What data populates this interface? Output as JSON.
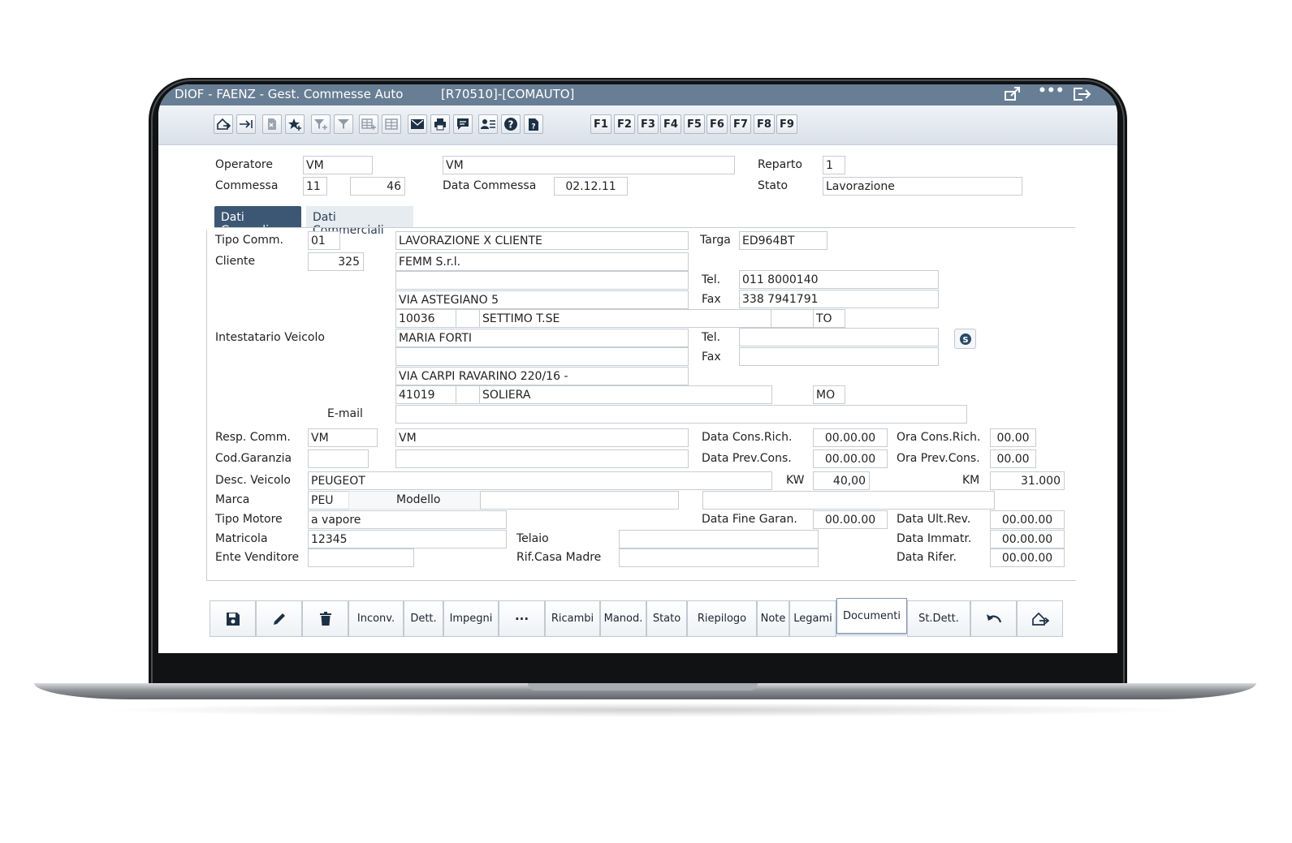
{
  "window": {
    "title": "DIOF  - FAENZ - Gest. Commesse Auto",
    "code": "[R70510]-[COMAUTO]"
  },
  "fkeys": [
    "F1",
    "F2",
    "F3",
    "F4",
    "F5",
    "F6",
    "F7",
    "F8",
    "F9"
  ],
  "header": {
    "operatore_label": "Operatore",
    "operatore_code": "VM",
    "operatore_name": "VM",
    "reparto_label": "Reparto",
    "reparto_value": "1",
    "commessa_label": "Commessa",
    "commessa_anno": "11",
    "commessa_num": "46",
    "data_commessa_label": "Data Commessa",
    "data_commessa_value": "02.12.11",
    "stato_label": "Stato",
    "stato_value": "Lavorazione"
  },
  "tabs": [
    "Dati Generali",
    "Dati Commerciali"
  ],
  "generali": {
    "tipo_comm_label": "Tipo Comm.",
    "tipo_comm_code": "01",
    "tipo_comm_desc": "LAVORAZIONE X CLIENTE",
    "targa_label": "Targa",
    "targa_value": "ED964BT",
    "cliente_label": "Cliente",
    "cliente_code": "325",
    "cliente_name": "FEMM S.r.l.",
    "cliente_line2": "",
    "cliente_tel_label": "Tel.",
    "cliente_tel": "011 8000140",
    "cliente_address": "VIA ASTEGIANO 5",
    "cliente_fax_label": "Fax",
    "cliente_fax": "338 7941791",
    "cliente_cap": "10036",
    "cliente_city": "SETTIMO T.SE",
    "cliente_prov": "TO",
    "intestatario_label": "Intestatario Veicolo",
    "intestatario_name": "MARIA FORTI",
    "intestatario_tel_label": "Tel.",
    "intestatario_tel": "",
    "intestatario_fax_label": "Fax",
    "intestatario_fax": "",
    "intestatario_address": "VIA CARPI RAVARINO 220/16  -",
    "intestatario_cap": "41019",
    "intestatario_city": "SOLIERA",
    "intestatario_prov": "MO",
    "email_label": "E-mail",
    "email_value": "",
    "resp_comm_label": "Resp. Comm.",
    "resp_comm_code": "VM",
    "resp_comm_name": "VM",
    "data_cons_rich_label": "Data Cons.Rich.",
    "data_cons_rich_value": "00.00.00",
    "ora_cons_rich_label": "Ora Cons.Rich.",
    "ora_cons_rich_value": "00.00",
    "cod_garanzia_label": "Cod.Garanzia",
    "data_prev_cons_label": "Data Prev.Cons.",
    "data_prev_cons_value": "00.00.00",
    "ora_prev_cons_label": "Ora Prev.Cons.",
    "ora_prev_cons_value": "00.00",
    "desc_veicolo_label": "Desc. Veicolo",
    "desc_veicolo_value": "PEUGEOT",
    "kw_label": "KW",
    "kw_value": "40,00",
    "km_label": "KM",
    "km_value": "31.000",
    "marca_label": "Marca",
    "marca_value": "PEU",
    "modello_label": "Modello",
    "tipo_motore_label": "Tipo Motore",
    "tipo_motore_value": "a vapore",
    "data_fine_garan_label": "Data Fine Garan.",
    "data_fine_garan_value": "00.00.00",
    "data_ult_rev_label": "Data Ult.Rev.",
    "data_ult_rev_value": "00.00.00",
    "matricola_label": "Matricola",
    "matricola_value": "12345",
    "telaio_label": "Telaio",
    "data_immatr_label": "Data Immatr.",
    "data_immatr_value": "00.00.00",
    "ente_venditore_label": "Ente Venditore",
    "rif_casa_madre_label": "Rif.Casa Madre",
    "data_rifer_label": "Data Rifer.",
    "data_rifer_value": "00.00.00"
  },
  "actions": {
    "inconv": "Inconv.",
    "dett": "Dett.",
    "impegni": "Impegni",
    "more": "···",
    "ricambi": "Ricambi",
    "manod": "Manod.",
    "stato": "Stato",
    "riepilogo": "Riepilogo",
    "note": "Note",
    "legami": "Legami",
    "documenti": "Documenti",
    "stdett": "St.Dett."
  }
}
